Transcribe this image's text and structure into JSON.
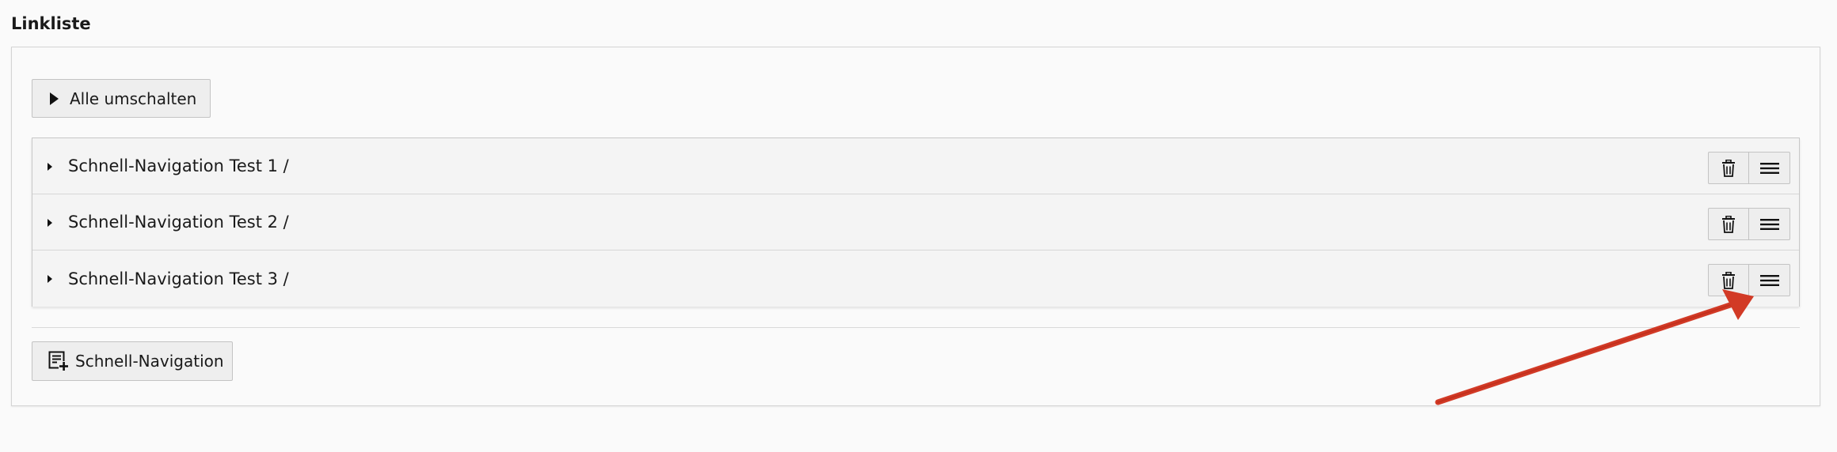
{
  "section": {
    "title": "Linkliste"
  },
  "toolbar": {
    "toggle_all_label": "Alle umschalten"
  },
  "items": [
    {
      "label": "Schnell-Navigation Test 1 /"
    },
    {
      "label": "Schnell-Navigation Test 2 /"
    },
    {
      "label": "Schnell-Navigation Test 3 /"
    }
  ],
  "actions": {
    "add_label": "Schnell-Navigation"
  },
  "icons": {
    "toggle": "play-triangle-icon",
    "caret": "caret-right-icon",
    "delete": "trash-icon",
    "drag": "drag-handle-icon",
    "add": "add-content-icon"
  },
  "colors": {
    "annotation_arrow": "#d23a26"
  }
}
